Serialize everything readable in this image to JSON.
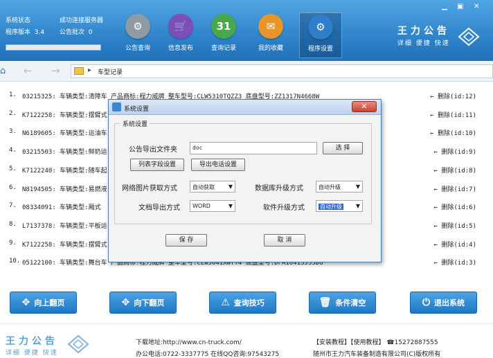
{
  "header": {
    "status_label": "系统状态",
    "version_label": "程序版本",
    "version_value": "3.4",
    "server_status": "成功连接服务器",
    "batch_label": "公告批次",
    "batch_value": "0",
    "progress_fraction": 0.0,
    "nav": [
      {
        "label": "公告查询",
        "icon": "tractor-icon",
        "color": "#8e9ba5",
        "glyph": "⚙"
      },
      {
        "label": "信息发布",
        "icon": "cart-icon",
        "color": "#7c4fb8",
        "glyph": "🛒"
      },
      {
        "label": "查询记录",
        "icon": "calendar-icon",
        "color": "#49a84a",
        "glyph": "31"
      },
      {
        "label": "我的收藏",
        "icon": "favorites-icon",
        "color": "#e8962a",
        "glyph": "✉"
      },
      {
        "label": "程序设置",
        "icon": "gear-icon",
        "color": "#2f7ecb",
        "glyph": "⚙"
      }
    ],
    "brand_big": "王力公告",
    "brand_small": "详细 便捷 快速"
  },
  "addressbar": {
    "crumb": "车型记录"
  },
  "rows": [
    {
      "no": "1.",
      "text": "03215325:  车辆类型:清障车  产品商标:程力威牌  整车型号:CLW5310TQZZ3  底盘型号:ZZ1317N4668W",
      "del": "← 删除(id:12)"
    },
    {
      "no": "2.",
      "text": "K7122258:  车辆类型:摆臂式",
      "del": "← 删除(id:11)"
    },
    {
      "no": "3.",
      "text": "N6189605:  车辆类型:运油车",
      "del": "← 删除(id:10)"
    },
    {
      "no": "4.",
      "text": "03215503:  车辆类型:鲜奶运",
      "del": "← 删除(id:9)"
    },
    {
      "no": "5.",
      "text": "K7122240:  车辆类型:随车起",
      "del": "← 删除(id:8)"
    },
    {
      "no": "6.",
      "text": "N8194505:  车辆类型:易燃液",
      "del": "← 删除(id:7)"
    },
    {
      "no": "7.",
      "text": "08334091:  车辆类型:厢式",
      "del": "← 删除(id:6)"
    },
    {
      "no": "8.",
      "text": "L7137378:  车辆类型:平板运",
      "del": "← 删除(id:5)"
    },
    {
      "no": "9.",
      "text": "K7122258:  车辆类型:摆臂式",
      "del": "← 删除(id:4)"
    },
    {
      "no": "10.",
      "text": "  05122100:  车辆类型:舞台车  产品商标:程力威牌  整车型号:CLW5041XWTT4  底盘型号:DFA1041SJ35D6",
      "del": "← 删除(id:3)"
    }
  ],
  "buttons": [
    {
      "label": "向上翻页",
      "glyph": "✥",
      "icon": "move-up-icon"
    },
    {
      "label": "向下翻页",
      "glyph": "✥",
      "icon": "move-down-icon"
    },
    {
      "label": "查询技巧",
      "glyph": "⚠",
      "icon": "warning-icon"
    },
    {
      "label": "条件清空",
      "glyph": "🗑",
      "icon": "trash-icon"
    },
    {
      "label": "退出系统",
      "glyph": "⏻",
      "icon": "power-icon"
    }
  ],
  "footer": {
    "brand_big": "王力公告",
    "brand_small": "详细 便捷 快速",
    "download": "下载地址:http://www.cn-truck.com/",
    "phone": "办公电话:0722-3337775  在线QQ咨询:97543275",
    "links": "【安装教程】【使用教程】 ☎15272887555",
    "company": "随州市王力汽车装备制造有限公司(C)版权所有"
  },
  "dialog": {
    "title": "系统设置",
    "close": "✕",
    "group_label": "系统设置",
    "export_dir_label": "公告导出文件夹",
    "export_dir_value": "doc",
    "browse_label": "选 择",
    "list_fields_label": "列表字段设置",
    "export_phone_label": "导出电话设置",
    "image_mode_label": "网络图片获取方式",
    "image_mode_value": "自动获取",
    "db_upgrade_label": "数据库升级方式",
    "db_upgrade_value": "自动升级",
    "doc_export_label": "文档导出方式",
    "doc_export_value": "WORD",
    "sw_upgrade_label": "软件升级方式",
    "sw_upgrade_value": "自动升级",
    "save_label": "保 存",
    "cancel_label": "取 消"
  }
}
